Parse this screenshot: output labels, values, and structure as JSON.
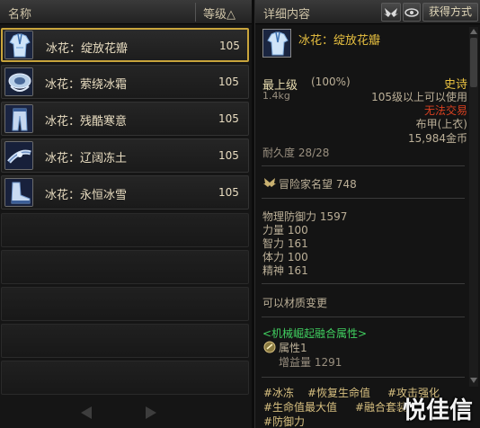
{
  "list": {
    "col_name": "名称",
    "col_level": "等级△",
    "items": [
      {
        "name": "冰花：绽放花瓣",
        "level": "105",
        "icon": "coat-icon"
      },
      {
        "name": "冰花：萦绕冰霜",
        "level": "105",
        "icon": "shoulder-icon"
      },
      {
        "name": "冰花：残酷寒意",
        "level": "105",
        "icon": "pants-icon"
      },
      {
        "name": "冰花：辽阔冻土",
        "level": "105",
        "icon": "belt-icon"
      },
      {
        "name": "冰花：永恒冰雪",
        "level": "105",
        "icon": "boots-icon"
      }
    ]
  },
  "detail": {
    "title": "详细内容",
    "acquire_label": "获得方式",
    "item_name": "冰花：绽放花瓣",
    "grade": "最上级",
    "grade_pct": "(100%)",
    "rarity": "史诗",
    "weight": "1.4kg",
    "level_req": "105级以上可以使用",
    "trade": "无法交易",
    "type": "布甲(上衣)",
    "price": "15,984金币",
    "durability": "耐久度 28/28",
    "fame_label": "冒险家名望 748",
    "stats": [
      "物理防御力 1597",
      "力量 100",
      "智力 161",
      "体力 100",
      "精神 161"
    ],
    "material_change": "可以材质变更",
    "fusion_title": "<机械崛起融合属性>",
    "fusion_attr": "属性1",
    "fusion_gain": "增益量 1291",
    "tags": [
      "#冰冻",
      "#恢复生命值",
      "#攻击强化",
      "#生命值最大值",
      "#融合套装",
      "#防御力"
    ]
  },
  "watermark": "悦佳信",
  "colors": {
    "gold": "#c8a43c",
    "epic": "#e8c040",
    "no_trade": "#d84020",
    "fusion": "#40d060"
  }
}
